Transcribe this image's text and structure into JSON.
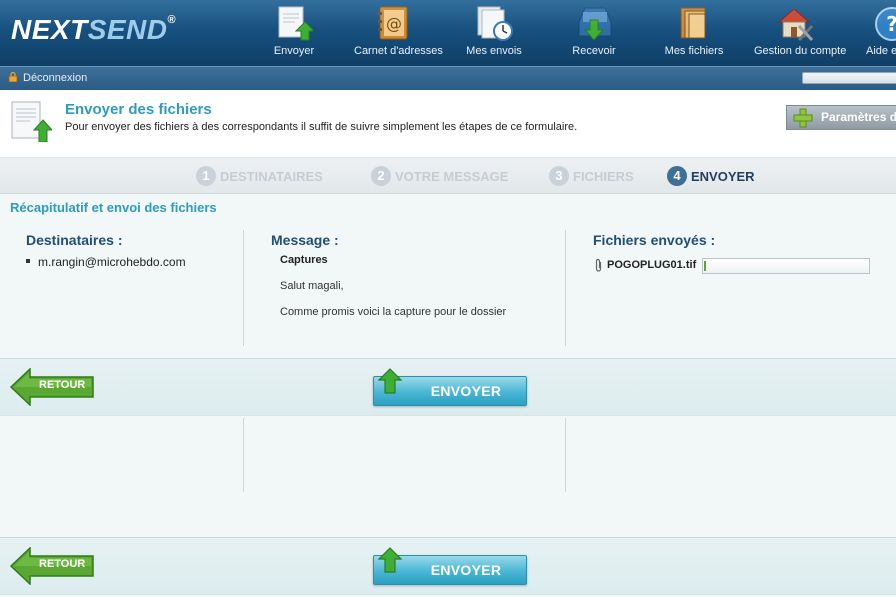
{
  "header": {
    "logo_main": "NEXT",
    "logo_accent": "SEND",
    "logo_mark": "®",
    "nav": [
      {
        "label": "Envoyer",
        "icon": "send-file-icon"
      },
      {
        "label": "Carnet d'adresses",
        "icon": "address-book-icon"
      },
      {
        "label": "Mes envois",
        "icon": "sent-files-clock-icon"
      },
      {
        "label": "Recevoir",
        "icon": "receive-icon"
      },
      {
        "label": "Mes fichiers",
        "icon": "folder-icon"
      },
      {
        "label": "Gestion du compte",
        "icon": "house-tools-icon"
      },
      {
        "label": "Aide et s",
        "icon": "help-icon"
      }
    ]
  },
  "subbar": {
    "logout_label": "Déconnexion"
  },
  "page": {
    "title": "Envoyer des fichiers",
    "description": "Pour envoyer des fichiers à des correspondants il suffit de suivre simplement les étapes de ce formulaire.",
    "params_button": "Paramètres d"
  },
  "steps": [
    {
      "num": "1",
      "label": "DESTINATAIRES",
      "active": false
    },
    {
      "num": "2",
      "label": "VOTRE MESSAGE",
      "active": false
    },
    {
      "num": "3",
      "label": "FICHIERS",
      "active": false
    },
    {
      "num": "4",
      "label": "ENVOYER",
      "active": true
    }
  ],
  "summary": {
    "title": "Récapitulatif et envoi des fichiers",
    "recipients_heading": "Destinataires :",
    "recipients": [
      "m.rangin@microhebdo.com"
    ],
    "message_heading": "Message :",
    "message_subject": "Captures",
    "message_lines": [
      "Salut magali,",
      "Comme promis voici la capture pour le dossier"
    ],
    "files_heading": "Fichiers envoyés :",
    "files": [
      {
        "name": "POGOPLUG01.tif",
        "progress": 0.01
      }
    ]
  },
  "actions": {
    "back_label": "RETOUR",
    "send_label": "ENVOYER"
  },
  "colors": {
    "accent": "#2f9bc1",
    "header_blue": "#17507f",
    "heading_blue": "#1f4f78",
    "button_cyan": "#49b6d4",
    "back_green": "#5aa832"
  }
}
